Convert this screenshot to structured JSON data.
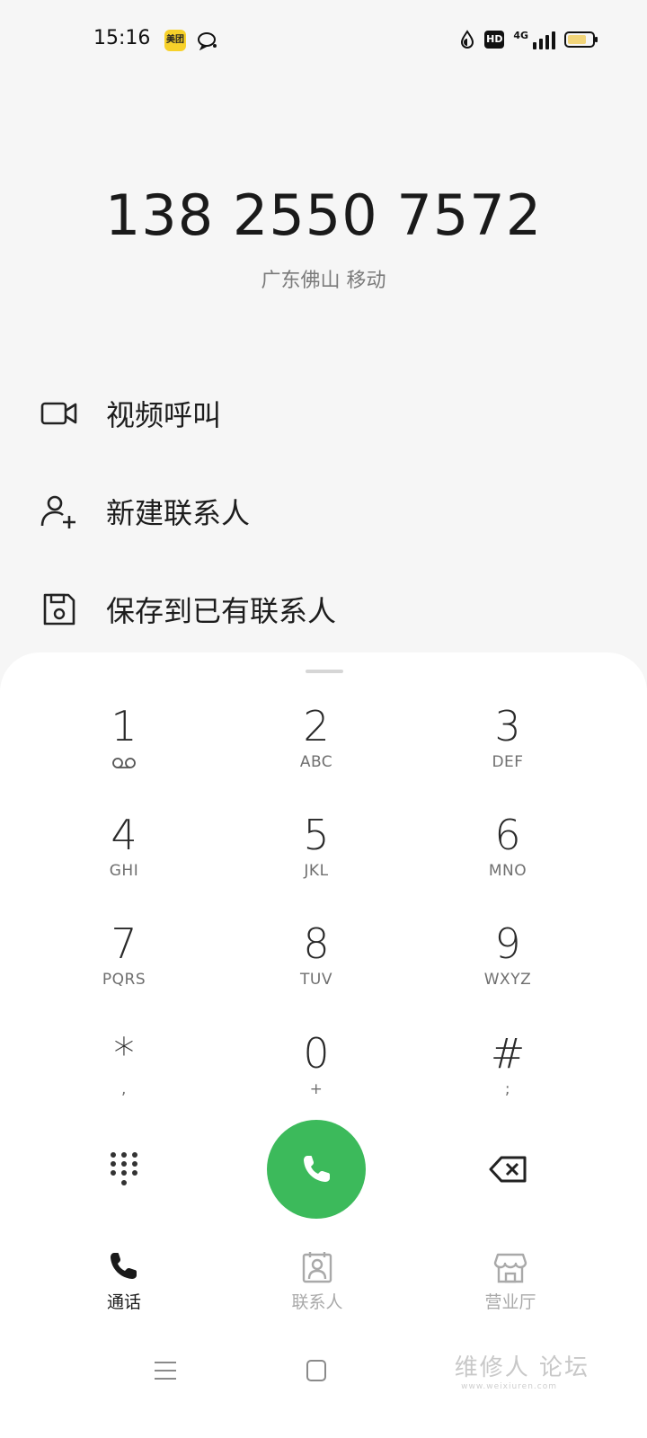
{
  "status_bar": {
    "time": "15:16",
    "meituan_badge": "美团",
    "hd_label": "HD",
    "network_label": "4G",
    "battery_level": 0.75,
    "icons": [
      "meituan-app-icon",
      "chat-icon",
      "data-saver-icon",
      "hd-voice-icon",
      "signal-icon",
      "battery-icon"
    ]
  },
  "dialed": {
    "number": "138 2550 7572",
    "location": "广东佛山 移动"
  },
  "actions": [
    {
      "label": "视频呼叫",
      "icon": "video-camera-icon"
    },
    {
      "label": "新建联系人",
      "icon": "add-person-icon"
    },
    {
      "label": "保存到已有联系人",
      "icon": "save-icon"
    }
  ],
  "keypad": [
    {
      "digit": "1",
      "letters": ""
    },
    {
      "digit": "2",
      "letters": "ABC"
    },
    {
      "digit": "3",
      "letters": "DEF"
    },
    {
      "digit": "4",
      "letters": "GHI"
    },
    {
      "digit": "5",
      "letters": "JKL"
    },
    {
      "digit": "6",
      "letters": "MNO"
    },
    {
      "digit": "7",
      "letters": "PQRS"
    },
    {
      "digit": "8",
      "letters": "TUV"
    },
    {
      "digit": "9",
      "letters": "WXYZ"
    },
    {
      "digit": "*",
      "letters": ","
    },
    {
      "digit": "0",
      "letters": "+"
    },
    {
      "digit": "#",
      "letters": ";"
    }
  ],
  "tabs": [
    {
      "label": "通话",
      "icon": "phone-icon",
      "active": true
    },
    {
      "label": "联系人",
      "icon": "contacts-icon",
      "active": false
    },
    {
      "label": "营业厅",
      "icon": "store-icon",
      "active": false
    }
  ],
  "colors": {
    "call_button": "#3cba5b",
    "active_tab": "#1a1a1a",
    "inactive_tab": "#a9a9a9"
  },
  "watermark": {
    "text": "维修人 论坛",
    "sub": "www.weixiuren.com"
  }
}
